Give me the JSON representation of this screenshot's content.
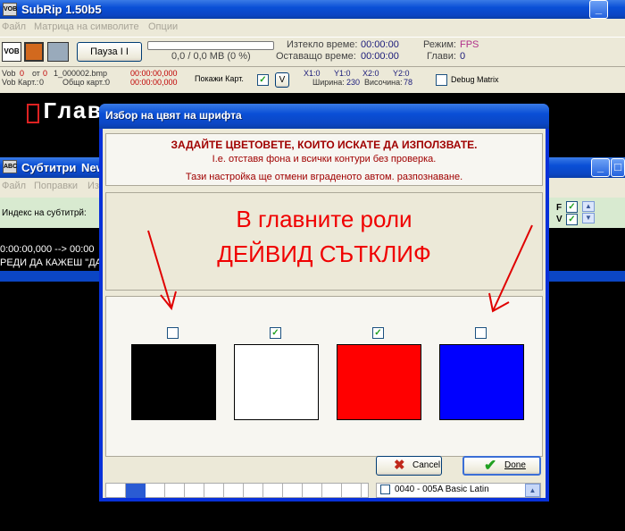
{
  "main_window": {
    "title": "SubRip 1.50b5",
    "menu": [
      "Файл",
      "Матрица на символите",
      "Опции"
    ],
    "toolbar": {
      "pause_button": "Пауза  I I",
      "progress_text": "0,0 / 0,0 MB (0 %)",
      "progress_value": 0,
      "elapsed_label": "Изтекло време:",
      "elapsed_value": "00:00:00",
      "remaining_label": "Оставащо време:",
      "remaining_value": "00:00:00",
      "mode_label": "Режим:",
      "mode_value": "FPS",
      "chapters_label": "Глави:",
      "chapters_value": "0"
    },
    "info": {
      "vob_label": "Vob",
      "vob_value": "0",
      "from_label": "от",
      "from_value": "0",
      "file": "1_000002.bmp",
      "vob_card_label": "Vob Карт.:",
      "vob_card_value": "0",
      "total_card_label": "Общо карт.:",
      "total_card_value": "0",
      "time1": "00:00:00,000",
      "time2": "00:00:00,000",
      "show_card_label": "Покажи Карт.",
      "v_button": "V",
      "x1": "X1:0",
      "y1": "Y1:0",
      "x2": "X2:0",
      "y2": "Y2:0",
      "width_label": "Ширина:",
      "width_value": "230",
      "height_label": "Височина:",
      "height_value": "78",
      "debug_matrix": "Debug Matrix"
    },
    "preview_text": "Главн"
  },
  "subs_window": {
    "title_part1": "Субтитри",
    "title_part2": "New",
    "menu": [
      "Файл",
      "Поправки",
      "Из"
    ],
    "index_label": "Индекс на субтитрй:",
    "f_label": "F",
    "v_label": "V",
    "line1": "0:00:00,000 --> 00:00",
    "line2": "РЕДИ ДА КАЖЕШ \"ДА"
  },
  "dialog": {
    "title": "Избор на цвят на шрифта",
    "header_main": "ЗАДАЙТЕ ЦВЕТОВЕТЕ, КОИТО ИСКАТЕ ДА ИЗПОЛЗВАТЕ.",
    "header_sub": "I.e. отставя фона и всички контури без проверка.",
    "header_note": "Тази настройка ще отмени вграденото автом. разпознаване.",
    "preview_line1": "В главните роли",
    "preview_line2": "ДЕЙВИД СЪТКЛИФ",
    "swatches": [
      {
        "color": "#000000",
        "checked": false
      },
      {
        "color": "#ffffff",
        "checked": true
      },
      {
        "color": "#ff0000",
        "checked": true
      },
      {
        "color": "#0000ff",
        "checked": false
      }
    ],
    "cancel_label": "Cancel",
    "done_label": "Done"
  },
  "unicode_list": {
    "item": "0040 - 005A Basic Latin"
  }
}
